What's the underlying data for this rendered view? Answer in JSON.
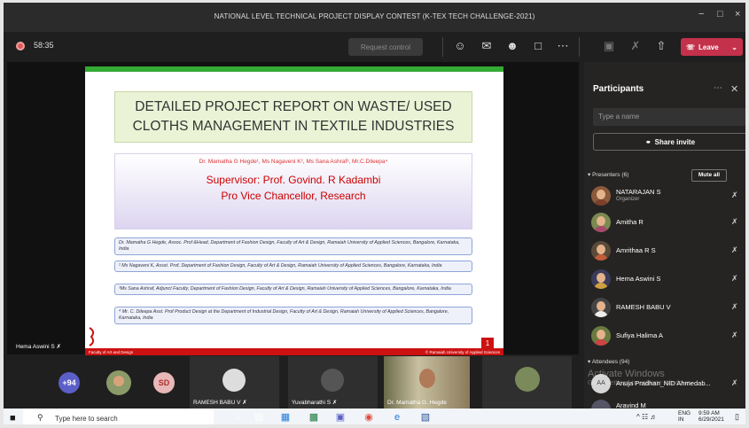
{
  "window": {
    "title": "NATIONAL LEVEL TECHNICAL PROJECT DISPLAY CONTEST (K-TEX TECH CHALLENGE-2021)",
    "minimize": "−",
    "maximize": "□",
    "close": "×"
  },
  "toolbar": {
    "timer": "58:35",
    "request_control": "Request control",
    "leave": "Leave"
  },
  "slide": {
    "title_line1": "DETAILED PROJECT REPORT ON WASTE/ USED",
    "title_line2": "CLOTHS MANAGEMENT IN TEXTILE INDUSTRIES",
    "authors": "Dr. Mamatha G Hegde¹, Ms Nagaveni K², Ms Sana Ashraf³, Mr.C.Dileepa⁴",
    "supervisor": "Supervisor: Prof. Govind. R Kadambi",
    "supervisor_title": "Pro Vice Chancellor, Research",
    "affiliations": [
      "Dr. Mamatha G Hegde, Assoc. Prof &Head, Department of Fashion Design, Faculty of Art & Design, Ramaiah University of Applied Sciences, Bangalore, Karnataka, India",
      "² Ms Nagaveni K, Assst. Prof, Department of Fashion Design, Faculty of Art & Design, Ramaiah University of Applied Sciences, Bangalore, Karnataka, India",
      "³Ms Sana Ashraf, Adjunct Faculty, Department of Fashion Design, Faculty of Art & Design, Ramaiah University of Applied Sciences, Bangalore, Karnataka, India",
      "⁴ Mr. C. Dileepa Asst. Prof Product Design at the Department of Industrial Design, Faculty of Art & Design, Ramaiah University of Applied Sciences, Bangalore, Karnataka, India"
    ],
    "footer_left": "Faculty of Art and Design",
    "footer_right": "© Ramaiah University of Applied Sciences",
    "page_number": "1"
  },
  "speaker_name": "Hema Aswini S",
  "participants": {
    "title": "Participants",
    "search_placeholder": "Type a name",
    "share_invite": "Share invite",
    "presenters_label": "Presenters (6)",
    "mute_all": "Mute all",
    "attendees_label": "Attendees (94)",
    "presenters": [
      {
        "name": "NATARAJAN S",
        "role": "Organizer"
      },
      {
        "name": "Amitha R",
        "role": ""
      },
      {
        "name": "Amrithaa R S",
        "role": ""
      },
      {
        "name": "Hema Aswini S",
        "role": ""
      },
      {
        "name": "RAMESH BABU V",
        "role": ""
      },
      {
        "name": "Sufiya Halima A",
        "role": ""
      }
    ],
    "attendees": [
      {
        "initials": "AA",
        "name": "Anuja Pradhan_NID Ahmedab..."
      },
      {
        "name": "Aravind M"
      }
    ]
  },
  "watermark": {
    "line1": "Activate Windows",
    "line2": "Go to Settings to activate Windows."
  },
  "tiles": {
    "overflow": "+94",
    "sd": "SD",
    "names": [
      "RAMESH BABU V",
      "Yuvabharathi S",
      "Dr. Mamatha G. Hegde"
    ]
  },
  "taskbar": {
    "search": "Type here to search",
    "lang": "ENG",
    "region": "IN",
    "time": "9:59 AM",
    "date": "6/29/2021"
  }
}
